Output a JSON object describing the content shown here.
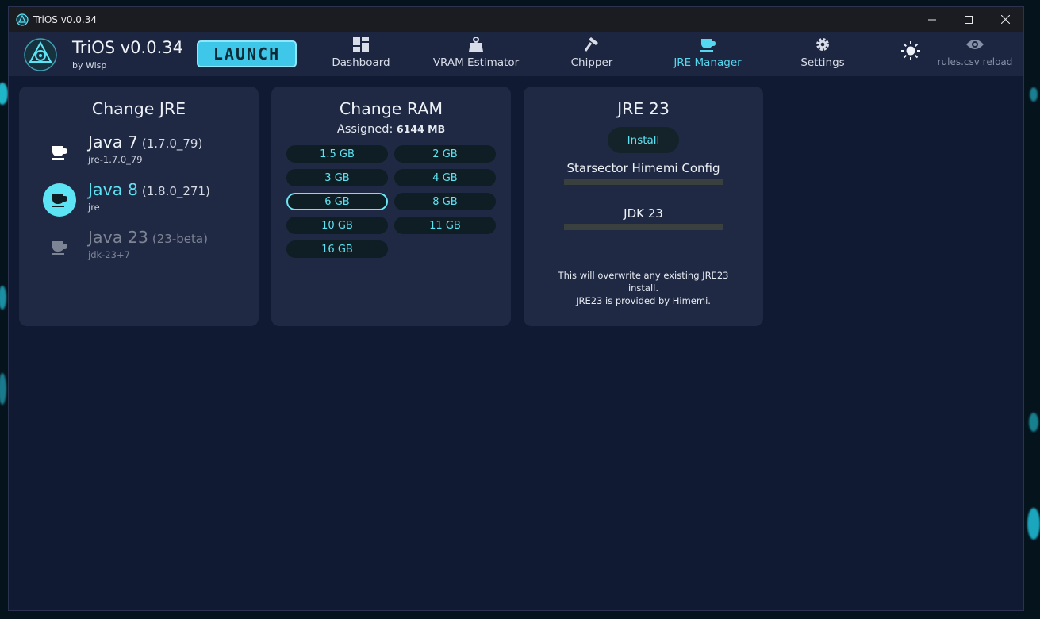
{
  "window": {
    "title": "TriOS v0.0.34"
  },
  "app": {
    "title": "TriOS v0.0.34",
    "subtitle": "by Wisp",
    "launch_label": "LAUNCH"
  },
  "nav": {
    "items": [
      {
        "label": "Dashboard",
        "icon": "dashboard-icon"
      },
      {
        "label": "VRAM Estimator",
        "icon": "weight-icon"
      },
      {
        "label": "Chipper",
        "icon": "hammer-icon"
      },
      {
        "label": "JRE Manager",
        "icon": "coffee-cup-icon",
        "active": true
      },
      {
        "label": "Settings",
        "icon": "gear-icon"
      }
    ],
    "theme_icon": "sun-icon",
    "reload_label": "rules.csv reload",
    "reload_icon": "eye-icon"
  },
  "colors": {
    "accent": "#5de4f4",
    "card": "#1f2943",
    "background": "#111a33",
    "appbar": "#1c2640"
  },
  "change_jre": {
    "title": "Change JRE",
    "items": [
      {
        "name": "Java 7",
        "version": "(1.7.0_79)",
        "path": "jre-1.7.0_79",
        "state": "available"
      },
      {
        "name": "Java 8",
        "version": "(1.8.0_271)",
        "path": "jre",
        "state": "selected"
      },
      {
        "name": "Java 23",
        "version": "(23-beta)",
        "path": "jdk-23+7",
        "state": "disabled"
      }
    ]
  },
  "change_ram": {
    "title": "Change RAM",
    "assigned_label": "Assigned:",
    "assigned_value": "6144 MB",
    "options": [
      "1.5 GB",
      "2 GB",
      "3 GB",
      "4 GB",
      "6 GB",
      "8 GB",
      "10 GB",
      "11 GB",
      "16 GB"
    ],
    "selected": "6 GB"
  },
  "jre23": {
    "title": "JRE 23",
    "install_label": "Install",
    "download1_label": "Starsector Himemi Config",
    "download1_progress": 0,
    "download2_label": "JDK 23",
    "download2_progress": 0,
    "note_line1": "This will overwrite any existing JRE23",
    "note_line2": "install.",
    "note_line3": "JRE23 is provided by Himemi."
  }
}
